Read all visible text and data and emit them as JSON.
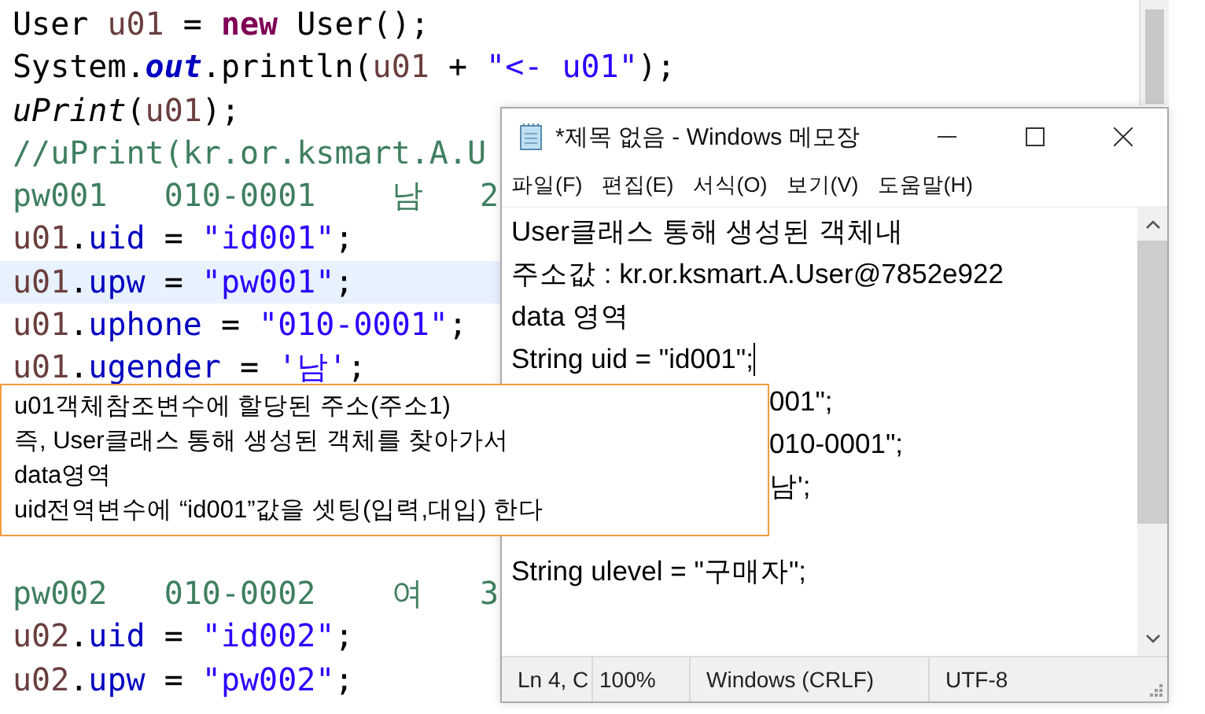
{
  "editor": {
    "lines_top": [
      {
        "selected": false,
        "tokens": [
          {
            "kind": "plain",
            "text": "User "
          },
          {
            "kind": "var",
            "text": "u01"
          },
          {
            "kind": "plain",
            "text": " = "
          },
          {
            "kind": "keyword",
            "text": "new"
          },
          {
            "kind": "plain",
            "text": " User();"
          }
        ]
      },
      {
        "selected": false,
        "tokens": [
          {
            "kind": "plain",
            "text": "System."
          },
          {
            "kind": "static",
            "text": "out"
          },
          {
            "kind": "plain",
            "text": ".println("
          },
          {
            "kind": "var",
            "text": "u01"
          },
          {
            "kind": "plain",
            "text": " + "
          },
          {
            "kind": "string",
            "text": "\"<- u01\""
          },
          {
            "kind": "plain",
            "text": ");"
          }
        ]
      },
      {
        "selected": false,
        "tokens": [
          {
            "kind": "method",
            "text": "uPrint"
          },
          {
            "kind": "plain",
            "text": "("
          },
          {
            "kind": "var",
            "text": "u01"
          },
          {
            "kind": "plain",
            "text": ");"
          }
        ]
      },
      {
        "selected": false,
        "tokens": [
          {
            "kind": "comment",
            "text": "//uPrint(kr.or.ksmart.A.U"
          }
        ]
      },
      {
        "selected": false,
        "tokens": [
          {
            "kind": "comment",
            "text": "pw001   010-0001    남   2"
          }
        ]
      },
      {
        "selected": false,
        "tokens": [
          {
            "kind": "var",
            "text": "u01"
          },
          {
            "kind": "plain",
            "text": "."
          },
          {
            "kind": "field",
            "text": "uid"
          },
          {
            "kind": "plain",
            "text": " = "
          },
          {
            "kind": "string",
            "text": "\"id001\""
          },
          {
            "kind": "plain",
            "text": ";"
          }
        ]
      },
      {
        "selected": true,
        "tokens": [
          {
            "kind": "var",
            "text": "u01"
          },
          {
            "kind": "plain",
            "text": "."
          },
          {
            "kind": "field",
            "text": "upw"
          },
          {
            "kind": "plain",
            "text": " = "
          },
          {
            "kind": "string",
            "text": "\"pw001\""
          },
          {
            "kind": "plain",
            "text": ";"
          }
        ]
      },
      {
        "selected": false,
        "tokens": [
          {
            "kind": "var",
            "text": "u01"
          },
          {
            "kind": "plain",
            "text": "."
          },
          {
            "kind": "field",
            "text": "uphone"
          },
          {
            "kind": "plain",
            "text": " = "
          },
          {
            "kind": "string",
            "text": "\"010-0001\""
          },
          {
            "kind": "plain",
            "text": ";"
          }
        ]
      },
      {
        "selected": false,
        "tokens": [
          {
            "kind": "var",
            "text": "u01"
          },
          {
            "kind": "plain",
            "text": "."
          },
          {
            "kind": "field",
            "text": "ugender"
          },
          {
            "kind": "plain",
            "text": " = "
          },
          {
            "kind": "string",
            "text": "'남'"
          },
          {
            "kind": "plain",
            "text": ";"
          }
        ]
      }
    ],
    "lines_bottom": [
      {
        "selected": false,
        "tokens": [
          {
            "kind": "comment",
            "text": "pw002   010-0002    여   3"
          }
        ]
      },
      {
        "selected": false,
        "tokens": [
          {
            "kind": "var",
            "text": "u02"
          },
          {
            "kind": "plain",
            "text": "."
          },
          {
            "kind": "field",
            "text": "uid"
          },
          {
            "kind": "plain",
            "text": " = "
          },
          {
            "kind": "string",
            "text": "\"id002\""
          },
          {
            "kind": "plain",
            "text": ";"
          }
        ]
      },
      {
        "selected": false,
        "tokens": [
          {
            "kind": "var",
            "text": "u02"
          },
          {
            "kind": "plain",
            "text": "."
          },
          {
            "kind": "field",
            "text": "upw"
          },
          {
            "kind": "plain",
            "text": " = "
          },
          {
            "kind": "string",
            "text": "\"pw002\""
          },
          {
            "kind": "plain",
            "text": ";"
          }
        ]
      }
    ]
  },
  "notepad": {
    "title": "*제목 없음 - Windows 메모장",
    "menu": [
      "파일(F)",
      "편집(E)",
      "서식(O)",
      "보기(V)",
      "도움말(H)"
    ],
    "lines": [
      {
        "kind": "full",
        "text": "User클래스 통해 생성된 객체내",
        "caret": false
      },
      {
        "kind": "full",
        "text": "주소값 : kr.or.ksmart.A.User@7852e922",
        "caret": false
      },
      {
        "kind": "full",
        "text": "data 영역",
        "caret": false
      },
      {
        "kind": "full",
        "text": "String uid = \"id001\";",
        "caret": true
      },
      {
        "kind": "cut",
        "text": "001\";",
        "caret": false
      },
      {
        "kind": "cut",
        "text": "010-0001\";",
        "caret": false
      },
      {
        "kind": "cut",
        "text": "남';",
        "caret": false
      },
      {
        "kind": "blank"
      },
      {
        "kind": "full",
        "text": "String ulevel = \"구매자\";",
        "caret": false
      }
    ],
    "status": [
      "Ln 4, C",
      "100%",
      "Windows (CRLF)",
      "UTF-8"
    ]
  },
  "note": {
    "lines": [
      "u01객체참조변수에 할당된 주소(주소1)",
      "즉, User클래스 통해 생성된 객체를 찾아가서",
      "data영역",
      "uid전역변수에 “id001”값을 셋팅(입력,대입) 한다"
    ]
  }
}
